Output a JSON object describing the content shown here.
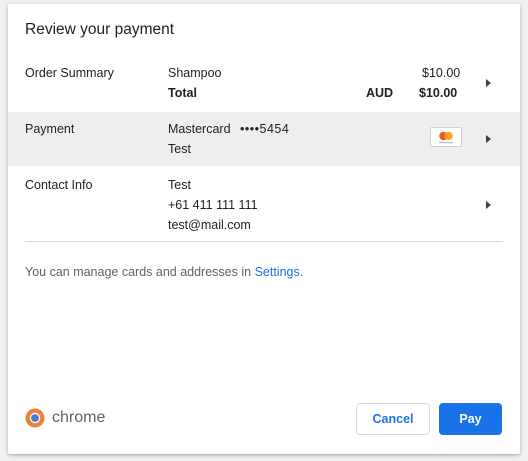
{
  "dialog": {
    "title": "Review your payment"
  },
  "order_summary": {
    "label": "Order Summary",
    "item_name": "Shampoo",
    "item_price": "$10.00",
    "total_label": "Total",
    "currency": "AUD",
    "total_price": "$10.00"
  },
  "payment": {
    "label": "Payment",
    "card_type": "Mastercard",
    "card_number": "••••5454",
    "card_holder": "Test",
    "card_icon": "mastercard-icon"
  },
  "contact": {
    "label": "Contact Info",
    "name": "Test",
    "phone": "+61 411 111 111",
    "email": "test@mail.com"
  },
  "footer": {
    "text_prefix": "You can manage cards and addresses in ",
    "link_text": "Settings",
    "text_suffix": "."
  },
  "branding": {
    "name": "chrome",
    "icon": "chrome-logo-icon"
  },
  "buttons": {
    "cancel": "Cancel",
    "pay": "Pay"
  },
  "colors": {
    "accent": "#1a73e8",
    "selected_row": "#eeeeee"
  }
}
